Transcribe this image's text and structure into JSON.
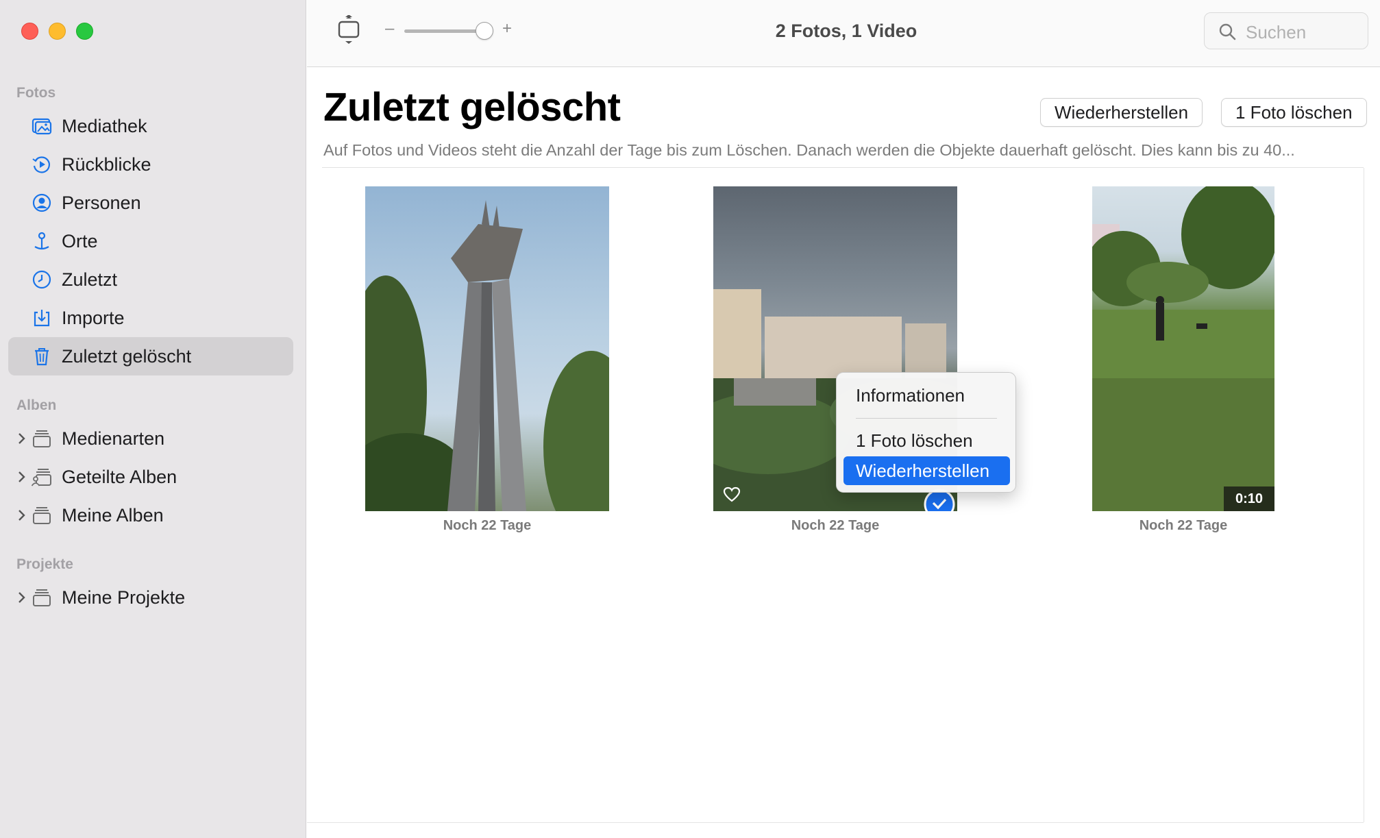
{
  "window": {
    "title": "2 Fotos, 1 Video"
  },
  "sidebar": {
    "sections": [
      {
        "header": "Fotos"
      },
      {
        "header": "Alben"
      },
      {
        "header": "Projekte"
      }
    ],
    "items": [
      {
        "label": "Mediathek",
        "icon": "library-icon"
      },
      {
        "label": "Rückblicke",
        "icon": "memories-icon"
      },
      {
        "label": "Personen",
        "icon": "people-icon"
      },
      {
        "label": "Orte",
        "icon": "places-icon"
      },
      {
        "label": "Zuletzt",
        "icon": "recents-icon"
      },
      {
        "label": "Importe",
        "icon": "imports-icon"
      },
      {
        "label": "Zuletzt gelöscht",
        "icon": "trash-icon",
        "active": true
      }
    ],
    "albums": [
      {
        "label": "Medienarten",
        "icon": "album-stack-icon"
      },
      {
        "label": "Geteilte Alben",
        "icon": "shared-album-icon"
      },
      {
        "label": "Meine Alben",
        "icon": "album-stack-icon"
      }
    ],
    "projects": [
      {
        "label": "Meine Projekte",
        "icon": "album-stack-icon"
      }
    ]
  },
  "toolbar": {
    "zoom_minus": "–",
    "zoom_plus": "+",
    "zoom_level": 0.85,
    "search_placeholder": "Suchen"
  },
  "main": {
    "title": "Zuletzt gelöscht",
    "restore_button": "Wiederherstellen",
    "delete_button": "1 Foto löschen",
    "info": "Auf Fotos und Videos steht die Anzahl der Tage bis zum Löschen. Danach werden die Objekte dauerhaft gelöscht. Dies kann bis zu 40..."
  },
  "items": [
    {
      "caption": "Noch 22 Tage",
      "type": "photo"
    },
    {
      "caption": "Noch 22 Tage",
      "type": "photo",
      "selected": true
    },
    {
      "caption": "Noch 22 Tage",
      "type": "video",
      "duration": "0:10"
    }
  ],
  "context_menu": {
    "items": [
      {
        "label": "Informationen"
      },
      {
        "label": "1 Foto löschen"
      },
      {
        "label": "Wiederherstellen",
        "highlighted": true
      }
    ]
  },
  "colors": {
    "accent": "#1a6ff0",
    "sidebar_icon": "#1a74e8",
    "sidebar_bg": "#e8e6e8"
  }
}
